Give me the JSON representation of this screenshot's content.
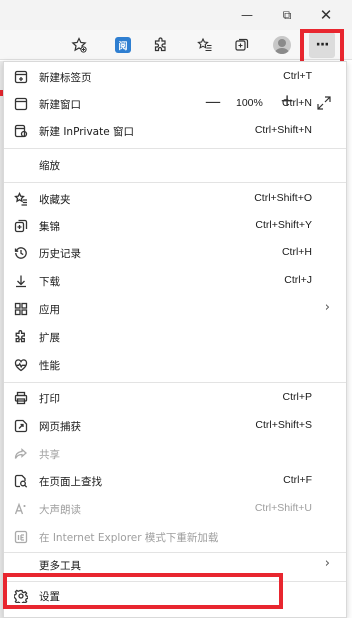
{
  "titlebar": {
    "minimize": "—",
    "restore": "⧉",
    "close": "✕"
  },
  "toolbar": {
    "reader_ext_label": "阅",
    "more_label": "···"
  },
  "menu": {
    "items": [
      {
        "label": "新建标签页",
        "shortcut": "Ctrl+T"
      },
      {
        "label": "新建窗口",
        "shortcut": "Ctrl+N"
      },
      {
        "label": "新建 InPrivate 窗口",
        "shortcut": "Ctrl+Shift+N"
      },
      {
        "label": "缩放",
        "shortcut": ""
      },
      {
        "label": "收藏夹",
        "shortcut": "Ctrl+Shift+O"
      },
      {
        "label": "集锦",
        "shortcut": "Ctrl+Shift+Y"
      },
      {
        "label": "历史记录",
        "shortcut": "Ctrl+H"
      },
      {
        "label": "下载",
        "shortcut": "Ctrl+J"
      },
      {
        "label": "应用",
        "shortcut": ""
      },
      {
        "label": "扩展",
        "shortcut": ""
      },
      {
        "label": "性能",
        "shortcut": ""
      },
      {
        "label": "打印",
        "shortcut": "Ctrl+P"
      },
      {
        "label": "网页捕获",
        "shortcut": "Ctrl+Shift+S"
      },
      {
        "label": "共享",
        "shortcut": ""
      },
      {
        "label": "在页面上查找",
        "shortcut": "Ctrl+F"
      },
      {
        "label": "大声朗读",
        "shortcut": "Ctrl+Shift+U"
      },
      {
        "label": "在 Internet Explorer 模式下重新加载",
        "shortcut": ""
      },
      {
        "label": "更多工具",
        "shortcut": ""
      },
      {
        "label": "设置",
        "shortcut": ""
      }
    ],
    "zoom": {
      "minus": "—",
      "value": "100%",
      "plus": "+"
    },
    "chevron": "›"
  }
}
